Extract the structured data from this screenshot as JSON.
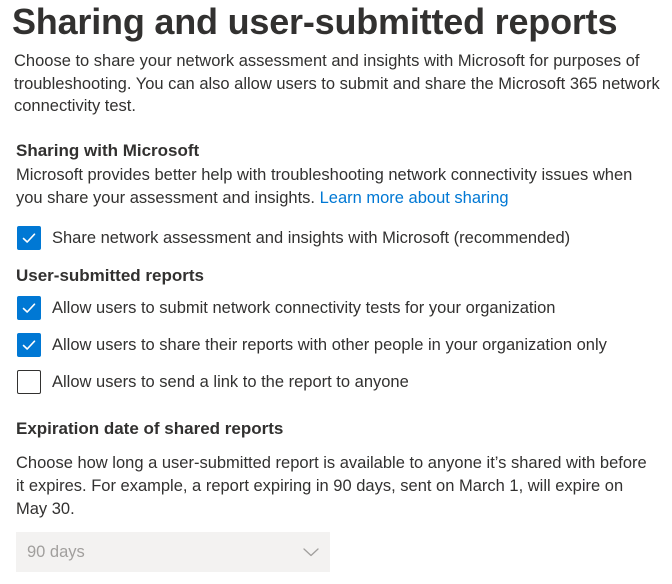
{
  "title": "Sharing and user-submitted reports",
  "intro": "Choose to share your network assessment and insights with Microsoft for purposes of troubleshooting. You can also allow users to submit and share the Microsoft 365 network connectivity test.",
  "sharing": {
    "heading": "Sharing with Microsoft",
    "description": "Microsoft provides better help with troubleshooting network connectivity issues when you share your assessment and insights.",
    "link_text": "Learn more about sharing",
    "checkbox": {
      "label": "Share network assessment and insights with Microsoft (recommended)",
      "checked": true
    }
  },
  "user_reports": {
    "heading": "User-submitted reports",
    "options": [
      {
        "label": "Allow users to submit network connectivity tests for your organization",
        "checked": true
      },
      {
        "label": "Allow users to share their reports with other people in your organization only",
        "checked": true
      },
      {
        "label": "Allow users to send a link to the report to anyone",
        "checked": false
      }
    ]
  },
  "expiration": {
    "heading": "Expiration date of shared reports",
    "description": "Choose how long a user-submitted report is available to anyone it’s shared with before it expires. For example, a report expiring in 90 days, sent on March 1, will expire on May 30.",
    "select": {
      "value": "90 days",
      "disabled": true,
      "icon": "chevron-down-icon"
    }
  },
  "colors": {
    "accent": "#0078d4",
    "text": "#323130",
    "disabled_text": "#a19f9d",
    "disabled_bg": "#f3f2f1"
  }
}
